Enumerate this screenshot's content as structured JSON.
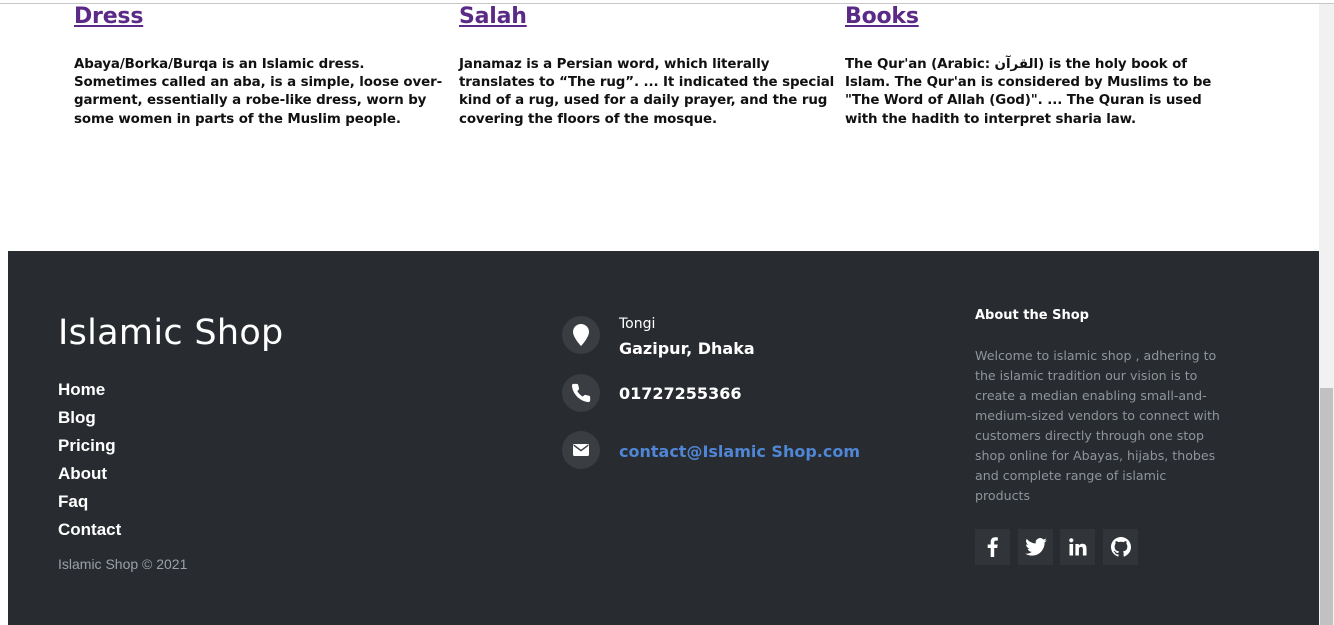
{
  "categories": [
    {
      "title": "Dress",
      "text": "Abaya/Borka/Burqa is an Islamic dress. Sometimes called an aba, is a simple, loose over-garment, essentially a robe-like dress, worn by some women in parts of the Muslim people."
    },
    {
      "title": "Salah",
      "text": "Janamaz is a Persian word, which literally translates to “The rug”. ... It indicated the special kind of a rug, used for a daily prayer, and the rug covering the floors of the mosque."
    },
    {
      "title": "Books",
      "text": "The Qur'an (Arabic: القرآن) is the holy book of Islam. The Qur'an is considered by Muslims to be \"The Word of Allah (God)\". ... The Quran is used with the hadith to interpret sharia law."
    }
  ],
  "footer": {
    "brand": "Islamic Shop",
    "nav": [
      "Home",
      "Blog",
      "Pricing",
      "About",
      "Faq",
      "Contact"
    ],
    "copyright": "Islamic Shop © 2021",
    "contact": {
      "address_line1": "Tongi",
      "address_line2": "Gazipur, Dhaka",
      "phone": "01727255366",
      "email": "contact@Islamic Shop.com",
      "icons": [
        "map-marker-icon",
        "phone-icon",
        "envelope-icon"
      ]
    },
    "about": {
      "title": "About the Shop",
      "text": "Welcome to islamic shop , adhering to the islamic tradition our vision is to create a median enabling small-and-medium-sized vendors to connect with customers directly through one stop shop online for Abayas, hijabs, thobes and complete range of islamic products"
    },
    "social": [
      "facebook-icon",
      "twitter-icon",
      "linkedin-icon",
      "github-icon"
    ]
  },
  "colors": {
    "link_purple": "#5b2a86",
    "footer_bg": "#282b2f",
    "email_blue": "#4f86d6",
    "muted_text": "#8f959b"
  }
}
